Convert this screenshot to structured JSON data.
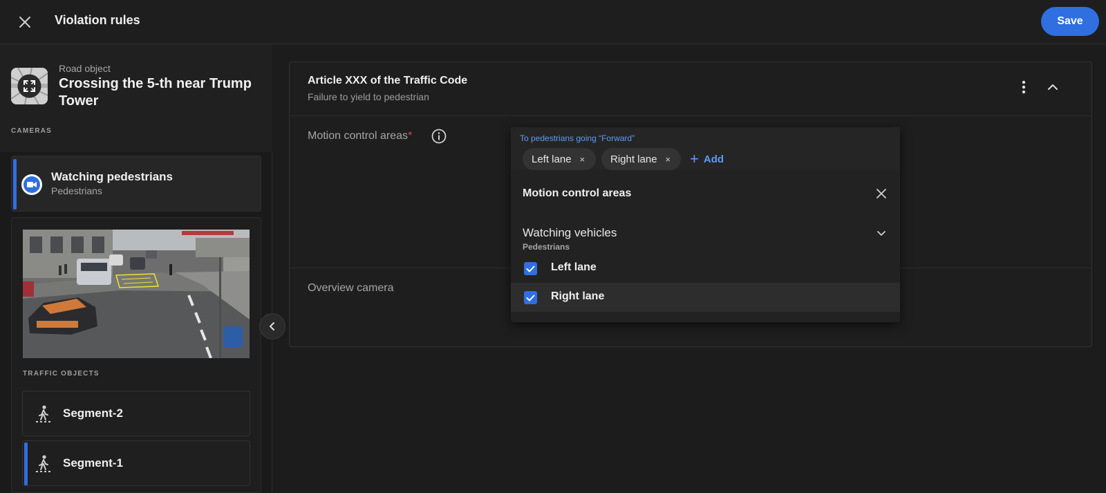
{
  "header": {
    "title": "Violation rules",
    "save_label": "Save"
  },
  "sidebar": {
    "road_object": {
      "kicker": "Road object",
      "name": "Crossing the 5-th near Trump Tower"
    },
    "cameras_label": "CAMERAS",
    "camera": {
      "name": "Watching pedestrians",
      "type": "Pedestrians"
    },
    "traffic_objects_label": "TRAFFIC OBJECTS",
    "segments": [
      {
        "label": "Segment-2",
        "selected": false
      },
      {
        "label": "Segment-1",
        "selected": true
      }
    ]
  },
  "rule": {
    "title": "Article XXX of the Traffic Code",
    "subtitle": "Failure to yield to pedestrian",
    "motion_label": "Motion control areas",
    "required_mark": "*",
    "overview_label": "Overview camera"
  },
  "dropdown": {
    "hint": "To pedestrians going “Forward”",
    "chips": [
      "Left lane",
      "Right lane"
    ],
    "chip_remove": "×",
    "add_label": "Add",
    "heading": "Motion control areas",
    "group": {
      "name": "Watching vehicles",
      "sub": "Pedestrians"
    },
    "options": [
      {
        "label": "Left lane",
        "checked": true
      },
      {
        "label": "Right lane",
        "checked": true
      }
    ]
  },
  "colors": {
    "accent": "#2f6fe0",
    "link": "#5b9cf6",
    "required": "#e0453b",
    "background": "#1c1c1c"
  },
  "icons": [
    "close-icon",
    "road-object-icon",
    "video-camera-icon",
    "pedestrian-icon",
    "chevron-left-icon",
    "more-vertical-icon",
    "chevron-up-icon",
    "info-icon",
    "plus-icon",
    "chevron-down-icon",
    "check-icon"
  ]
}
